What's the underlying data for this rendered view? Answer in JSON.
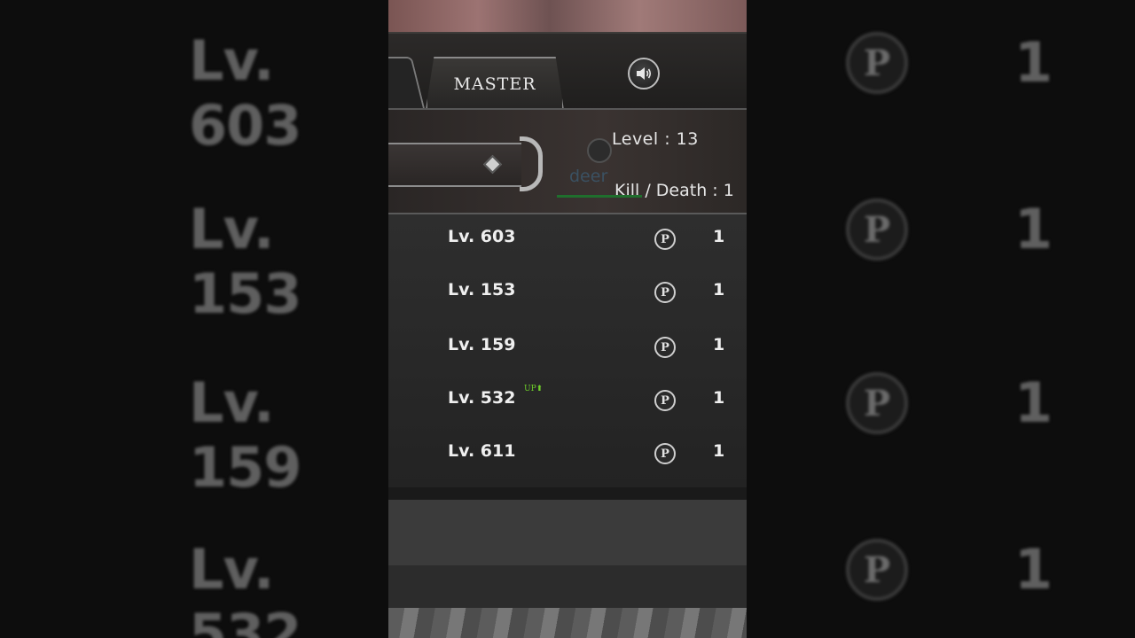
{
  "header": {
    "active_tab": "MASTER",
    "sound_icon": "speaker-icon"
  },
  "profile": {
    "level_label": "Level : 13",
    "player_name": "deer",
    "kill_death_label": "Kill / Death : 1"
  },
  "rows": [
    {
      "level": "Lv. 603",
      "up_badge": "",
      "currency_icon": "P",
      "count": "1"
    },
    {
      "level": "Lv. 153",
      "up_badge": "",
      "currency_icon": "P",
      "count": "1"
    },
    {
      "level": "Lv. 159",
      "up_badge": "",
      "currency_icon": "P",
      "count": "1"
    },
    {
      "level": "Lv. 532",
      "up_badge": "UP⬆",
      "currency_icon": "P",
      "count": "1"
    },
    {
      "level": "Lv. 611",
      "up_badge": "",
      "currency_icon": "P",
      "count": "1"
    }
  ],
  "colors": {
    "up_badge": "#6fcf2a",
    "exp_bar": "#1f6f2d",
    "text": "#efefef"
  }
}
